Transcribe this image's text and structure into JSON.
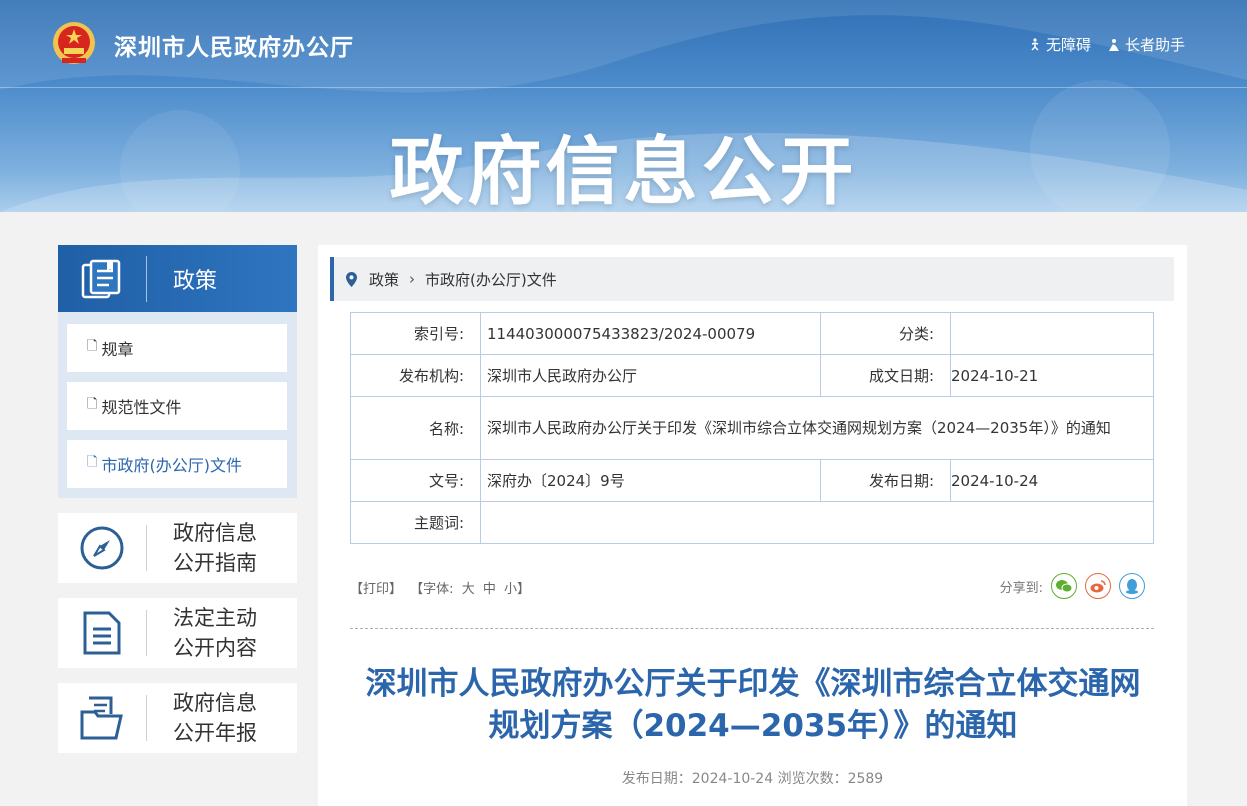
{
  "header": {
    "site_title": "深圳市人民政府办公厅",
    "links": [
      {
        "label": "无障碍",
        "icon": "accessibility-icon"
      },
      {
        "label": "长者助手",
        "icon": "elder-assist-icon"
      }
    ],
    "banner_title": "政府信息公开"
  },
  "sidebar": {
    "policy_label": "政策",
    "items": [
      {
        "label": "规章"
      },
      {
        "label": "规范性文件"
      },
      {
        "label": "市政府(办公厅)文件"
      }
    ],
    "cards": [
      {
        "line1": "政府信息",
        "line2": "公开指南"
      },
      {
        "line1": "法定主动",
        "line2": "公开内容"
      },
      {
        "line1": "政府信息",
        "line2": "公开年报"
      }
    ]
  },
  "breadcrumb": {
    "items": [
      "政策",
      "市政府(办公厅)文件"
    ]
  },
  "meta": {
    "index_label": "索引号:",
    "index_value": "11440300007543382​3/2024-00079",
    "category_label": "分类:",
    "category_value": "",
    "org_label": "发布机构:",
    "org_value": "深圳市人民政府办公厅",
    "created_label": "成文日期:",
    "created_value": "2024-10-21",
    "name_label": "名称:",
    "name_value": "深圳市人民政府办公厅关于印发《深圳市综合立体交通网规划方案（2024—2035年）》的通知",
    "docno_label": "文号:",
    "docno_value": "深府办〔2024〕9号",
    "pubdate_label": "发布日期:",
    "pubdate_value": "2024-10-24",
    "topic_label": "主题词:",
    "topic_value": ""
  },
  "tools": {
    "print": "【打印】",
    "font_label": "【字体:",
    "font_large": "大",
    "font_medium": "中",
    "font_small": "小】",
    "share_label": "分享到:"
  },
  "article": {
    "title_line1": "深圳市人民政府办公厅关于印发《深圳市综合立体交通网",
    "title_line2": "规划方案（2024—2035年）》的通知",
    "meta": "发布日期：2024-10-24  浏览次数：2589"
  },
  "colors": {
    "accent": "#2c66ad",
    "wechat": "#5bb12f",
    "weibo": "#e6693b",
    "qq": "#3f9fd9"
  }
}
